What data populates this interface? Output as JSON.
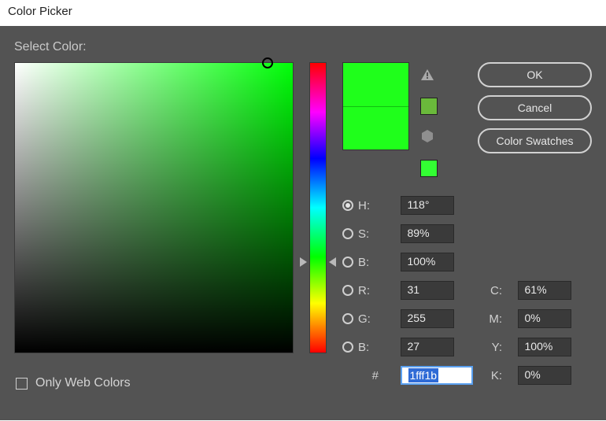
{
  "window": {
    "title": "Color Picker"
  },
  "labels": {
    "select_color": "Select Color:",
    "only_web": "Only Web Colors",
    "hash": "#"
  },
  "buttons": {
    "ok": "OK",
    "cancel": "Cancel",
    "swatches": "Color Swatches"
  },
  "modes": {
    "h": "H:",
    "s": "S:",
    "b": "B:",
    "r": "R:",
    "g": "G:",
    "b2": "B:"
  },
  "cmyk_labels": {
    "c": "C:",
    "m": "M:",
    "y": "Y:",
    "k": "K:"
  },
  "values": {
    "h": "118°",
    "s": "89%",
    "b": "100%",
    "r": "31",
    "g": "255",
    "b2": "27",
    "hex": "1fff1b",
    "c": "61%",
    "m": "0%",
    "y": "100%",
    "k": "0%"
  },
  "colors": {
    "current": "#1fff1b",
    "previous": "#1fff1b",
    "websafe": "#33ff33",
    "nearest": "#6ab93b"
  }
}
